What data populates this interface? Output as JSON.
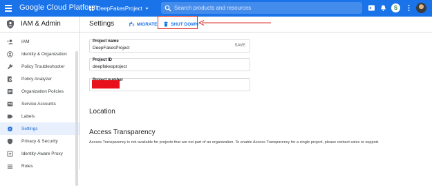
{
  "topbar": {
    "brand": "Google Cloud Platform",
    "project_name": "DeepFakesProject",
    "search_placeholder": "Search products and resources",
    "account_initial": "S"
  },
  "sidebar": {
    "title": "IAM & Admin",
    "items": [
      {
        "label": "IAM",
        "icon": "person-add-icon"
      },
      {
        "label": "Identity & Organization",
        "icon": "account-circle-icon"
      },
      {
        "label": "Policy Troubleshooter",
        "icon": "wrench-icon"
      },
      {
        "label": "Policy Analyzer",
        "icon": "document-search-icon"
      },
      {
        "label": "Organization Policies",
        "icon": "list-box-icon"
      },
      {
        "label": "Service Accounts",
        "icon": "service-account-icon"
      },
      {
        "label": "Labels",
        "icon": "label-icon"
      },
      {
        "label": "Settings",
        "icon": "gear-icon",
        "active": true
      },
      {
        "label": "Privacy & Security",
        "icon": "shield-icon"
      },
      {
        "label": "Identity-Aware Proxy",
        "icon": "iap-icon"
      },
      {
        "label": "Roles",
        "icon": "roles-icon"
      }
    ]
  },
  "main": {
    "title": "Settings",
    "migrate_label": "MIGRATE",
    "shutdown_label": "SHUT DOWN",
    "project_name_label": "Project name",
    "project_name_value": "DeepFakesProject",
    "save_label": "SAVE",
    "project_id_label": "Project ID",
    "project_id_value": "deepfakesproject",
    "project_number_label": "Project number",
    "location_heading": "Location",
    "access_heading": "Access Transparency",
    "access_text": "Access Transparency is not available for projects that are not part of an organization. To enable Access Transparency for a single project, please contact sales or support."
  },
  "colors": {
    "topbar": "#1a73e8",
    "accent": "#1a73e8",
    "active_nav_bg": "#e8f0fe",
    "annotation_red": "#d93025",
    "redaction_red": "#e8101a"
  }
}
